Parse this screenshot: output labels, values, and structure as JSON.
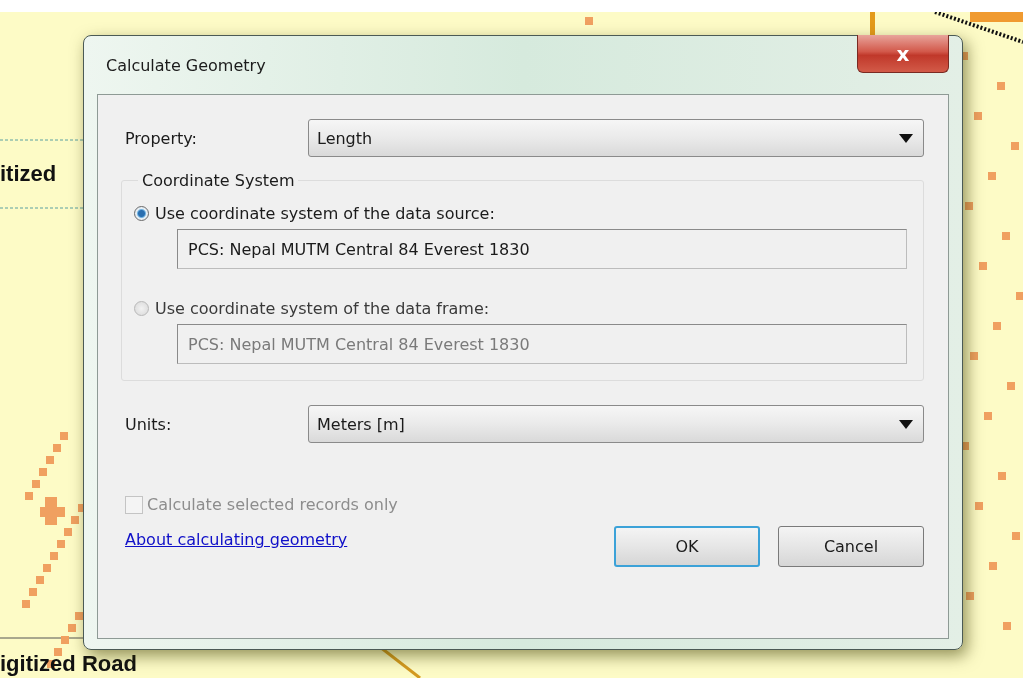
{
  "map_labels": [
    {
      "text": "itized",
      "kind": "upper"
    },
    {
      "text": "igitized Road",
      "kind": "lower"
    }
  ],
  "dialog": {
    "title": "Calculate Geometry",
    "close": "x",
    "property": {
      "label": "Property:",
      "value": "Length"
    },
    "coordinate_system": {
      "legend": "Coordinate System",
      "options": [
        {
          "label": "Use coordinate system of the data source:",
          "selected": true,
          "value": "PCS: Nepal MUTM Central 84 Everest 1830",
          "disabled": false
        },
        {
          "label": "Use coordinate system of the data frame:",
          "selected": false,
          "value": "PCS: Nepal MUTM Central 84 Everest 1830",
          "disabled": true
        }
      ]
    },
    "units": {
      "label": "Units:",
      "value": "Meters [m]"
    },
    "selected_only": {
      "label": "Calculate selected records only",
      "checked": false,
      "disabled": true
    },
    "help_link": "About calculating geometry",
    "buttons": [
      {
        "label": "OK",
        "default": true
      },
      {
        "label": "Cancel",
        "default": false
      }
    ]
  }
}
